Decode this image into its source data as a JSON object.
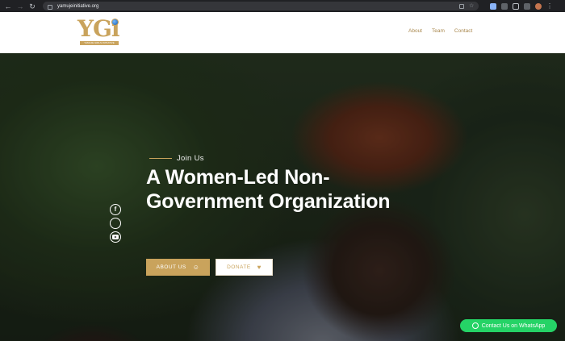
{
  "browser": {
    "url": "yamujeinitiative.org",
    "back_glyph": "←",
    "forward_glyph": "→",
    "reload_glyph": "↻",
    "menu_glyph": "⋮",
    "bookmark_glyph": "☆"
  },
  "site": {
    "logo": {
      "mark": "YGi",
      "subtitle": "YAMUJE GIRLS INITIATIVE"
    },
    "nav": [
      "About",
      "Team",
      "Contact"
    ]
  },
  "hero": {
    "eyebrow": "Join Us",
    "headline": "A Women-Led Non-Government Organization",
    "social": [
      "facebook-icon",
      "twitter-icon",
      "youtube-icon"
    ],
    "social_glyphs": {
      "facebook": "f"
    },
    "buttons": {
      "about": {
        "label": "ABOUT US",
        "icon_glyph": "☺"
      },
      "donate": {
        "label": "DONATE",
        "icon_glyph": "♥"
      }
    }
  },
  "whatsapp": {
    "label": "Contact Us on WhatsApp"
  },
  "colors": {
    "accent": "#c9a35c",
    "whatsapp": "#25d366",
    "chrome": "#202124"
  }
}
